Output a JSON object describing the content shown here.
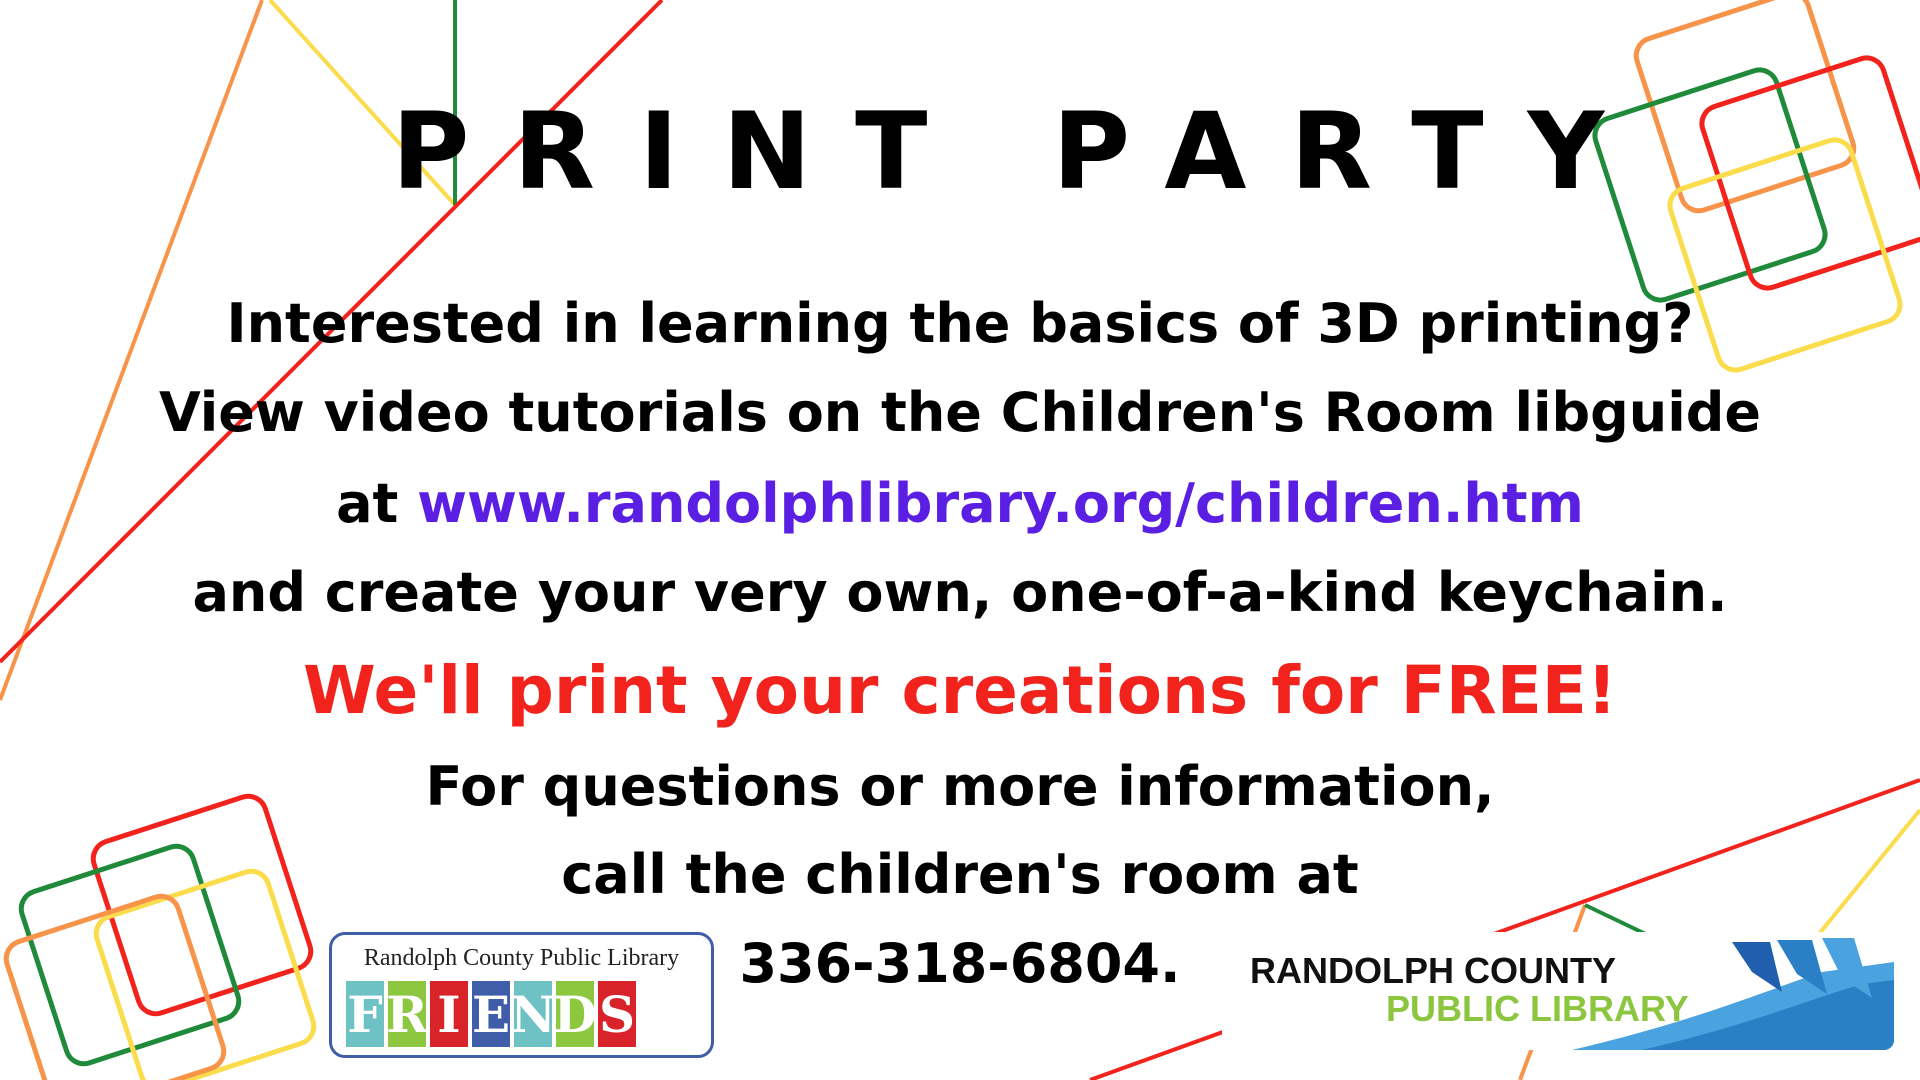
{
  "title": "PRINT PARTY",
  "body": {
    "line1": "Interested in learning the basics of 3D printing?",
    "line2": "View video tutorials on the Children's Room libguide",
    "line3_prefix": "at ",
    "line3_url": "www.randolphlibrary.org/children.htm",
    "line4": "and create your very own, one-of-a-kind keychain.",
    "highlight": "We'll print your creations for FREE!",
    "line6": "For questions or more information,",
    "line7": "call the children's room at",
    "phone": "336-318-6804."
  },
  "logos": {
    "friends": {
      "top_text": "Randolph County Public Library",
      "letters": [
        "F",
        "R",
        "I",
        "E",
        "N",
        "D",
        "S"
      ],
      "letter_colors": [
        "#6fc2c4",
        "#8dc63f",
        "#d8232a",
        "#3f5da8",
        "#6fc2c4",
        "#8dc63f",
        "#d8232a"
      ]
    },
    "library": {
      "line1": "RANDOLPH COUNTY",
      "line2": "PUBLIC LIBRARY"
    }
  },
  "colors": {
    "red": "#f2231c",
    "orange": "#f7944a",
    "yellow": "#fbdc4d",
    "green": "#1f8a3a",
    "url": "#5b1fe3"
  }
}
